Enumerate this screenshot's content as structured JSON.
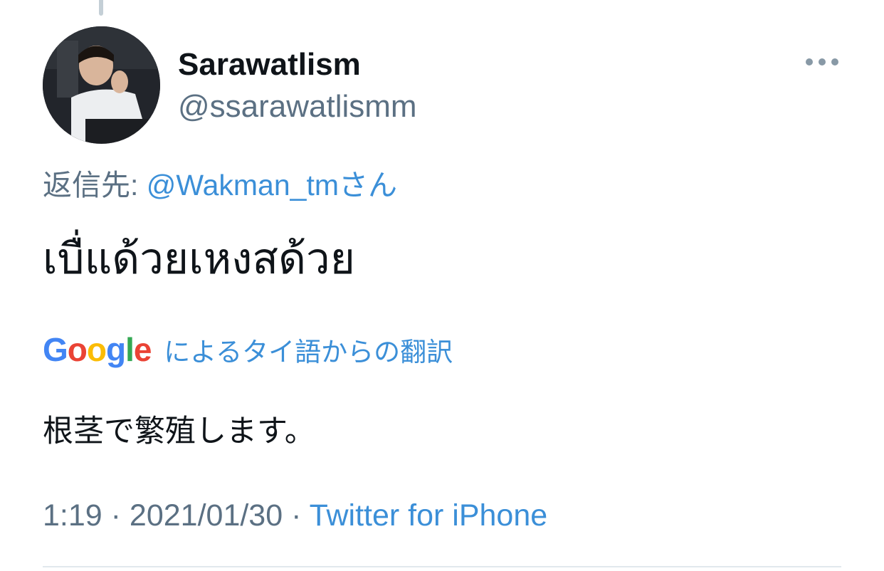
{
  "tweet": {
    "author": {
      "display_name": "Sarawatlism",
      "handle": "@ssarawatlismm"
    },
    "reply_prefix": "返信先: ",
    "reply_to": "@Wakman_tmさん",
    "text": "เบื่แด้วยเหงสด้วย",
    "translation": {
      "provider_logo": [
        "G",
        "o",
        "o",
        "g",
        "l",
        "e"
      ],
      "logo_colors": [
        "#4285F4",
        "#EA4335",
        "#FBBC05",
        "#4285F4",
        "#34A853",
        "#EA4335"
      ],
      "label": "によるタイ語からの翻訳",
      "text": "根茎で繁殖します。"
    },
    "time": "1:19",
    "date": "2021/01/30",
    "separator": " · ",
    "source": "Twitter for iPhone"
  },
  "colors": {
    "link": "#3b8fd8",
    "secondary": "#5b7083",
    "primary": "#0f1419"
  }
}
